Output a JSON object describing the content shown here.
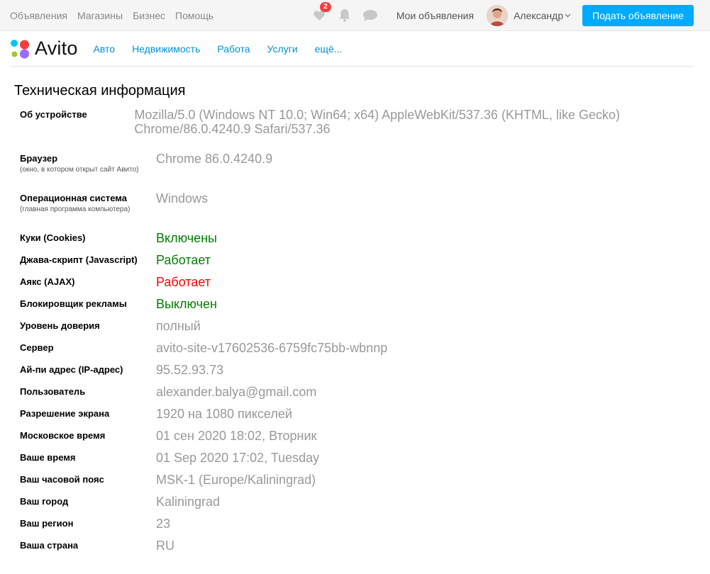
{
  "topbar": {
    "links": [
      "Объявления",
      "Магазины",
      "Бизнес",
      "Помощь"
    ],
    "favorites_count": "2",
    "my_ads": "Мои объявления",
    "username": "Александр",
    "post_button": "Подать объявление"
  },
  "nav": {
    "logo": "Avito",
    "categories": [
      "Авто",
      "Недвижимость",
      "Работа",
      "Услуги",
      "ещё..."
    ]
  },
  "page_title": "Техническая информация",
  "rows": [
    {
      "label": "Об устройстве",
      "value": "Mozilla/5.0 (Windows NT 10.0; Win64; x64) AppleWebKit/537.36 (KHTML, like Gecko) Chrome/86.0.4240.9 Safari/537.36"
    },
    {
      "label": "Браузер",
      "sub": "(окно, в котором открыт сайт Авито)",
      "value": "Chrome 86.0.4240.9"
    },
    {
      "label": "Операционная система",
      "sub": "(главная программа компьютера)",
      "value": "Windows"
    },
    {
      "label": "Куки (Cookies)",
      "value": "Включены",
      "color": "#008000"
    },
    {
      "label": "Джава-скрипт (Javascript)",
      "value": "Работает",
      "color": "#008000"
    },
    {
      "label": "Аякс (AJAX)",
      "value": "Работает",
      "color": "#ff0000"
    },
    {
      "label": "Блокировщик рекламы",
      "value": "Выключен",
      "color": "#008000"
    },
    {
      "label": "Уровень доверия",
      "value": "полный"
    },
    {
      "label": "Сервер",
      "value": "avito-site-v17602536-6759fc75bb-wbnnp"
    },
    {
      "label": "Ай-пи адрес (IP-адрес)",
      "value": "95.52.93.73"
    },
    {
      "label": "Пользователь",
      "value": "alexander.balya@gmail.com"
    },
    {
      "label": "Разрешение экрана",
      "value": "1920 на 1080 пикселей"
    },
    {
      "label": "Московское время",
      "value": "01 сен 2020 18:02, Вторник"
    },
    {
      "label": "Ваше время",
      "value": "01 Sep 2020 17:02, Tuesday"
    },
    {
      "label": "Ваш часовой пояс",
      "value": "MSK-1 (Europe/Kaliningrad)"
    },
    {
      "label": "Ваш город",
      "value": "Kaliningrad"
    },
    {
      "label": "Ваш регион",
      "value": "23"
    },
    {
      "label": "Ваша страна",
      "value": "RU"
    }
  ],
  "icons": [
    "heart-icon",
    "bell-icon",
    "chat-icon",
    "chevron-down-icon"
  ]
}
